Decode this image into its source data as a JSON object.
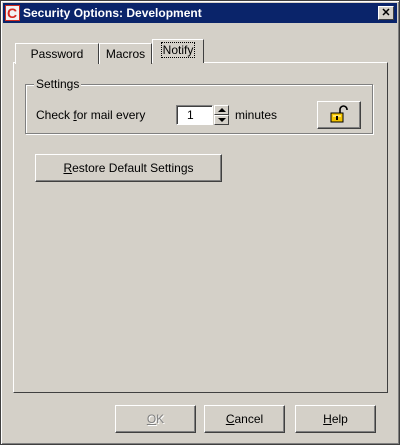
{
  "window": {
    "title": "Security Options: Development",
    "app_icon_letter": "C",
    "close_glyph": "✕",
    "icons": {
      "app": "app-logo-icon",
      "close": "close-icon"
    }
  },
  "tabs": [
    {
      "label": "Password",
      "active": false
    },
    {
      "label": "Macros",
      "active": false
    },
    {
      "label": "Notify",
      "active": true
    }
  ],
  "settings": {
    "group_label": "Settings",
    "check_prefix": "Check ",
    "check_mnemonic": "f",
    "check_suffix": "or mail every",
    "interval_value": "1",
    "interval_unit": "minutes",
    "lock_icon": "unlocked-padlock-icon",
    "spin_icons": {
      "up": "arrow-up-icon",
      "down": "arrow-down-icon"
    }
  },
  "restore": {
    "mnemonic": "R",
    "rest": "estore Default Settings"
  },
  "footer": {
    "ok": {
      "mnemonic": "O",
      "rest": "K",
      "enabled": false
    },
    "cancel": {
      "mnemonic": "C",
      "rest": "ancel"
    },
    "help": {
      "mnemonic": "H",
      "rest": "elp"
    }
  },
  "colors": {
    "dialog_face": "#d4d0c8",
    "title_bar": "#0a246a",
    "title_text": "#ffffff",
    "disabled_text": "#808080",
    "lock_gold": "#f3c300"
  }
}
